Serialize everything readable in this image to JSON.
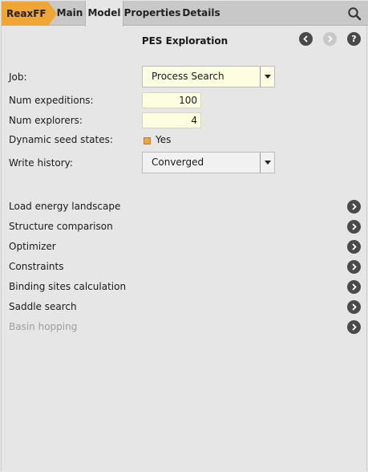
{
  "tabs": {
    "engine": "ReaxFF",
    "main": "Main",
    "model": "Model",
    "properties": "Properties",
    "details": "Details"
  },
  "header": {
    "title": "PES Exploration"
  },
  "form": {
    "job_label": "Job:",
    "job_value": "Process Search",
    "num_expeditions_label": "Num expeditions:",
    "num_expeditions_value": "100",
    "num_explorers_label": "Num explorers:",
    "num_explorers_value": "4",
    "dynamic_seed_label": "Dynamic seed states:",
    "dynamic_seed_value": "Yes",
    "dynamic_seed_checked": true,
    "write_history_label": "Write history:",
    "write_history_value": "Converged"
  },
  "panels": [
    {
      "label": "Load energy landscape",
      "enabled": true
    },
    {
      "label": "Structure comparison",
      "enabled": true
    },
    {
      "label": "Optimizer",
      "enabled": true
    },
    {
      "label": "Constraints",
      "enabled": true
    },
    {
      "label": "Binding sites calculation",
      "enabled": true
    },
    {
      "label": "Saddle search",
      "enabled": true
    },
    {
      "label": "Basin hopping",
      "enabled": false
    }
  ],
  "colors": {
    "accent": "#f0a633",
    "field_bg": "#fdfde0",
    "panel_bg": "#e6e6e6",
    "button_dark": "#4a4a4a",
    "disabled_text": "#9e9e9e"
  }
}
